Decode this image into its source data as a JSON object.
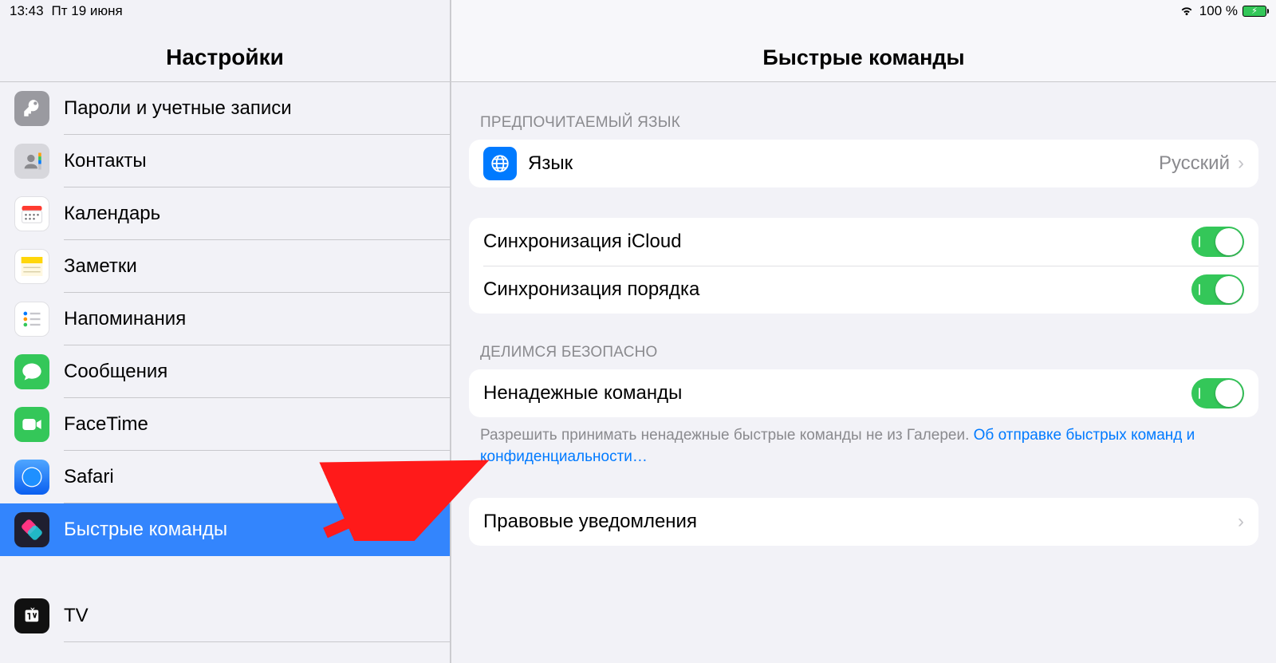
{
  "status": {
    "time": "13:43",
    "date": "Пт 19 июня",
    "battery": "100 %"
  },
  "sidebar": {
    "title": "Настройки",
    "items": [
      {
        "id": "passwords",
        "label": "Пароли и учетные записи"
      },
      {
        "id": "contacts",
        "label": "Контакты"
      },
      {
        "id": "calendar",
        "label": "Календарь"
      },
      {
        "id": "notes",
        "label": "Заметки"
      },
      {
        "id": "reminders",
        "label": "Напоминания"
      },
      {
        "id": "messages",
        "label": "Сообщения"
      },
      {
        "id": "facetime",
        "label": "FaceTime"
      },
      {
        "id": "safari",
        "label": "Safari"
      },
      {
        "id": "shortcuts",
        "label": "Быстрые команды"
      },
      {
        "id": "tv",
        "label": "TV"
      }
    ]
  },
  "detail": {
    "title": "Быстрые команды",
    "group_lang_header": "ПРЕДПОЧИТАЕМЫЙ ЯЗЫК",
    "row_language_label": "Язык",
    "row_language_value": "Русский",
    "row_icloud_sync": "Синхронизация iCloud",
    "row_order_sync": "Синхронизация порядка",
    "group_share_header": "ДЕЛИМСЯ БЕЗОПАСНО",
    "row_untrusted": "Ненадежные команды",
    "footer_text": "Разрешить принимать ненадежные быстрые команды не из Галереи. ",
    "footer_link": "Об отправке быстрых команд и конфиденциальности…",
    "row_legal": "Правовые уведомления"
  }
}
